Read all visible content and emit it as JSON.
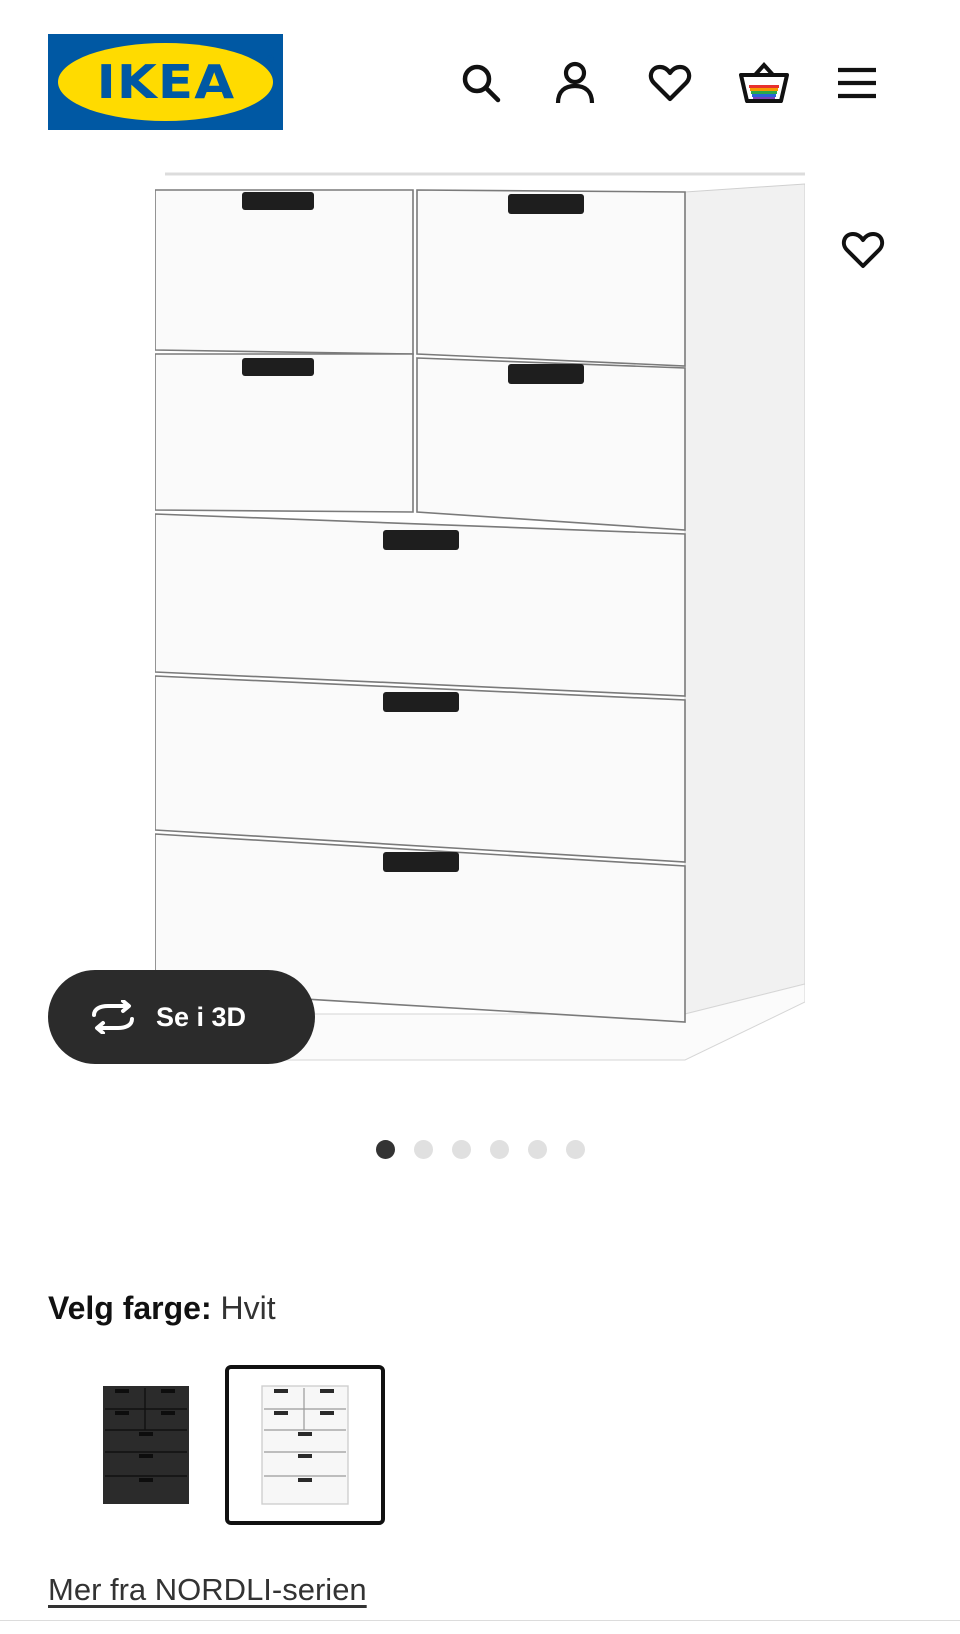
{
  "brand": {
    "logo_text": "IKEA",
    "registered_mark": "®"
  },
  "header": {
    "icons": [
      "search-icon",
      "user-icon",
      "heart-icon",
      "basket-icon",
      "menu-icon"
    ]
  },
  "product": {
    "view_3d_label": "Se i 3D",
    "image_count": 6,
    "active_image": 1
  },
  "color": {
    "label": "Velg farge:",
    "selected": "Hvit",
    "options": [
      {
        "name": "antrasitt",
        "color": "#2e2e2e"
      },
      {
        "name": "Hvit",
        "color": "#f4f4f4"
      }
    ]
  },
  "series_link": "Mer fra NORDLI-serien",
  "colors": {
    "ikea_blue": "#0058a3",
    "ikea_yellow": "#ffdb00",
    "dark_button": "#2b2b2b"
  }
}
